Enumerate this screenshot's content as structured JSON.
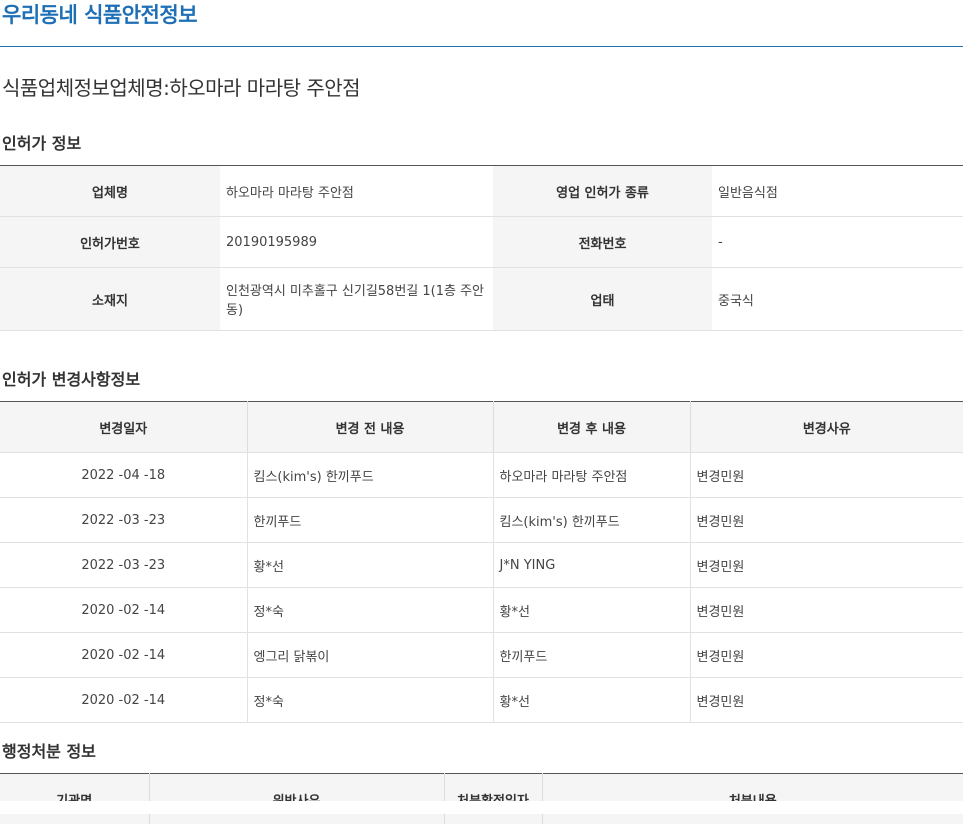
{
  "site": {
    "title": "우리동네 식품안전정보"
  },
  "page": {
    "heading": "식품업체정보업체명:하오마라 마라탕 주안점"
  },
  "permit_section": {
    "title": "인허가 정보",
    "rows": [
      {
        "label1": "업체명",
        "value1": "하오마라 마라탕 주안점",
        "label2": "영업 인허가 종류",
        "value2": "일반음식점"
      },
      {
        "label1": "인허가번호",
        "value1": "20190195989",
        "label2": "전화번호",
        "value2": "-"
      },
      {
        "label1": "소재지",
        "value1": "인천광역시 미추홀구 신기길58번길 1(1층 주안동)",
        "label2": "업태",
        "value2": "중국식"
      }
    ]
  },
  "changes_section": {
    "title": "인허가 변경사항정보",
    "headers": [
      "변경일자",
      "변경 전 내용",
      "변경 후 내용",
      "변경사유"
    ],
    "rows": [
      {
        "date": "2022 -04 -18",
        "before": "킴스(kim's) 한끼푸드",
        "after": "하오마라 마라탕 주안점",
        "reason": "변경민원"
      },
      {
        "date": "2022 -03 -23",
        "before": "한끼푸드",
        "after": "킴스(kim's) 한끼푸드",
        "reason": "변경민원"
      },
      {
        "date": "2022 -03 -23",
        "before": "황*선",
        "after": "J*N YING",
        "reason": "변경민원"
      },
      {
        "date": "2020 -02 -14",
        "before": "정*숙",
        "after": "황*선",
        "reason": "변경민원"
      },
      {
        "date": "2020 -02 -14",
        "before": "엥그리 닭볶이",
        "after": "한끼푸드",
        "reason": "변경민원"
      },
      {
        "date": "2020 -02 -14",
        "before": "정*숙",
        "after": "황*선",
        "reason": "변경민원"
      }
    ]
  },
  "admin_section": {
    "title": "행정처분 정보",
    "headers": [
      "기관명",
      "위반사유",
      "처분확정일자",
      "처분내용"
    ]
  },
  "colors": {
    "accent": "#1e6fb5",
    "header_bg": "#f5f5f5"
  }
}
